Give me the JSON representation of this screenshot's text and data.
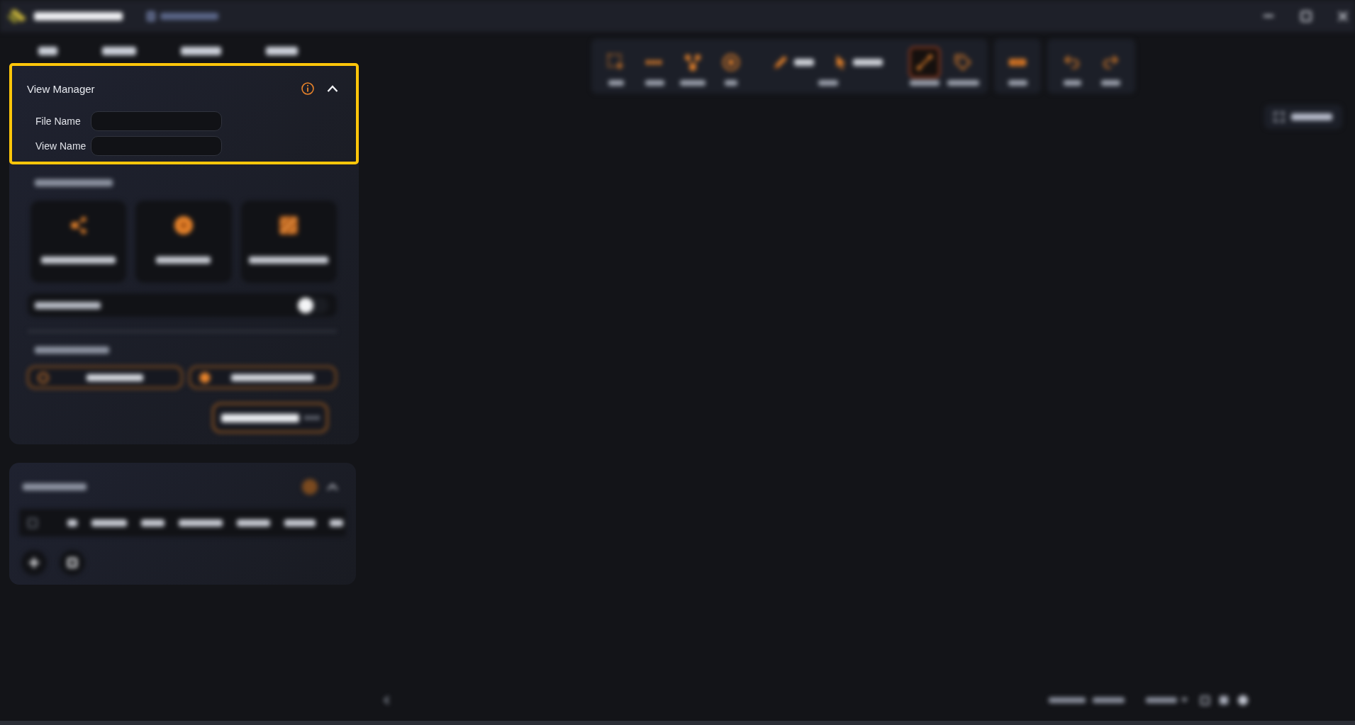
{
  "view_manager": {
    "title": "View Manager",
    "expanded": true,
    "fields": [
      {
        "label": "File Name"
      },
      {
        "label": "View Name"
      }
    ]
  },
  "sidebar_panel": {
    "toggle": {
      "on": false
    }
  },
  "table_panel": {
    "expanded": true,
    "select_all": {
      "checked": false
    }
  },
  "toolbar": {
    "groups": [
      {
        "items": [
          {
            "kind": "tool",
            "selected": false
          },
          {
            "kind": "tool",
            "selected": false
          },
          {
            "kind": "tool",
            "selected": false
          },
          {
            "kind": "tool",
            "selected": false
          },
          {
            "kind": "mode"
          },
          {
            "kind": "tool",
            "selected": true
          },
          {
            "kind": "tool",
            "selected": false
          }
        ]
      },
      {
        "items": [
          {
            "kind": "tool",
            "selected": false
          }
        ]
      },
      {
        "items": [
          {
            "kind": "tool",
            "selected": false
          },
          {
            "kind": "tool",
            "selected": false
          }
        ]
      }
    ]
  }
}
